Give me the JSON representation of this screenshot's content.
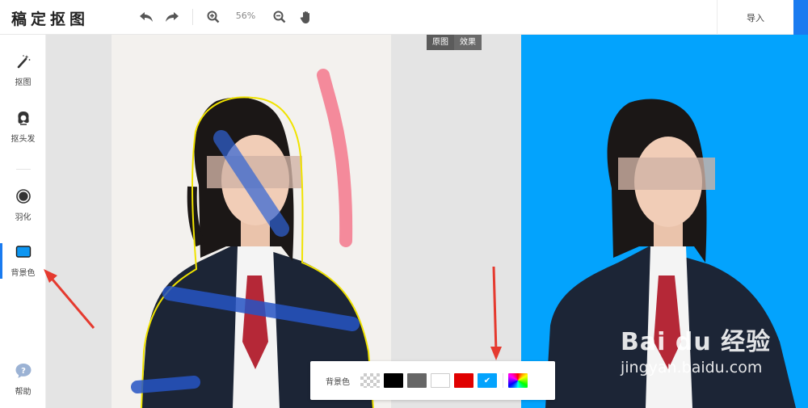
{
  "app": {
    "logo": "稿定抠图"
  },
  "toolbar": {
    "undo_icon": "undo-icon",
    "redo_icon": "redo-icon",
    "zoom_in_icon": "zoom-in-icon",
    "zoom_level": "56%",
    "zoom_out_icon": "zoom-out-icon",
    "hand_icon": "hand-icon",
    "import_label": "导入"
  },
  "sidebar": {
    "items": [
      {
        "label": "抠图",
        "icon": "magic-wand-icon"
      },
      {
        "label": "抠头发",
        "icon": "hair-icon"
      },
      {
        "label": "羽化",
        "icon": "feather-circle-icon"
      },
      {
        "label": "背景色",
        "icon": "background-color-icon"
      }
    ],
    "help_label": "帮助",
    "active_item": "背景色"
  },
  "view_toggle": {
    "original": "原图",
    "effect": "效果"
  },
  "palette": {
    "label": "背景色",
    "swatches": [
      {
        "name": "transparent",
        "color": "transparent"
      },
      {
        "name": "black",
        "color": "#000000"
      },
      {
        "name": "gray",
        "color": "#666666"
      },
      {
        "name": "white",
        "color": "#ffffff"
      },
      {
        "name": "red",
        "color": "#e00000"
      },
      {
        "name": "blue",
        "color": "#03a3fd",
        "selected": true
      },
      {
        "name": "custom",
        "color": "rainbow"
      }
    ]
  },
  "colors": {
    "accent": "#1a7bf0",
    "canvas_bg": "#e4e4e4",
    "result_bg": "#03a3fd",
    "keep_stroke": "#2f63d6",
    "remove_stroke": "#f48a9b",
    "outline": "#f0e300",
    "annotation": "#e53a2f"
  },
  "watermark": {
    "brand": "Bai du 经验",
    "url": "jingyan.baidu.com"
  }
}
